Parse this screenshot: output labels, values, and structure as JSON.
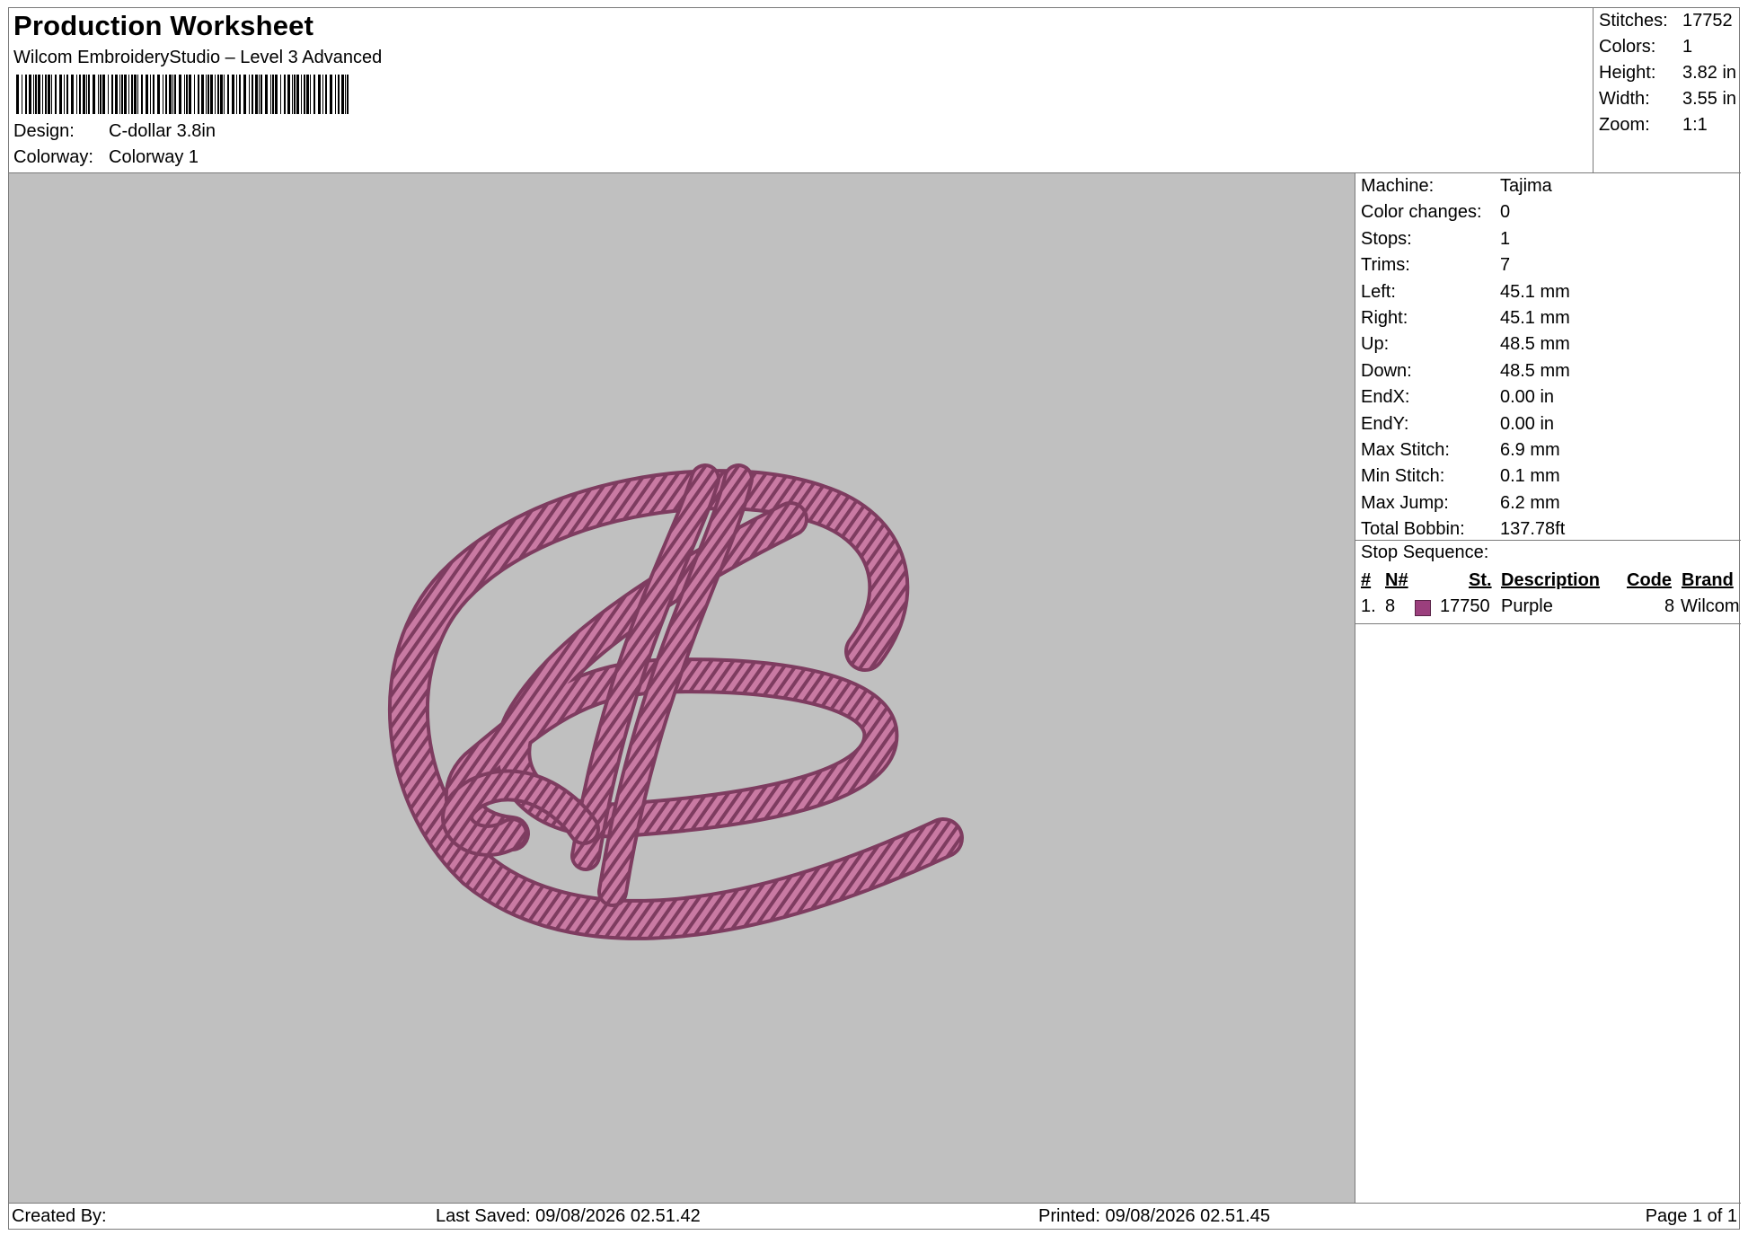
{
  "header": {
    "title": "Production Worksheet",
    "software": "Wilcom EmbroideryStudio – Level 3 Advanced",
    "design_label": "Design:",
    "design_value": "C-dollar 3.8in",
    "colorway_label": "Colorway:",
    "colorway_value": "Colorway 1"
  },
  "stats": [
    {
      "label": "Stitches:",
      "value": "17752"
    },
    {
      "label": "Colors:",
      "value": "1"
    },
    {
      "label": "Height:",
      "value": "3.82 in"
    },
    {
      "label": "Width:",
      "value": "3.55 in"
    },
    {
      "label": "Zoom:",
      "value": "1:1"
    }
  ],
  "machine_info": [
    {
      "label": "Machine:",
      "value": "Tajima"
    },
    {
      "label": "Color changes:",
      "value": "0"
    },
    {
      "label": "Stops:",
      "value": "1"
    },
    {
      "label": "Trims:",
      "value": "7"
    },
    {
      "label": "Left:",
      "value": "45.1 mm"
    },
    {
      "label": "Right:",
      "value": "45.1 mm"
    },
    {
      "label": "Up:",
      "value": "48.5 mm"
    },
    {
      "label": "Down:",
      "value": "48.5 mm"
    },
    {
      "label": "EndX:",
      "value": "0.00 in"
    },
    {
      "label": "EndY:",
      "value": "0.00 in"
    },
    {
      "label": "Max Stitch:",
      "value": "6.9 mm"
    },
    {
      "label": "Min Stitch:",
      "value": "0.1 mm"
    },
    {
      "label": "Max Jump:",
      "value": "6.2 mm"
    },
    {
      "label": "Total Bobbin:",
      "value": "137.78ft"
    }
  ],
  "stop_sequence": {
    "title": "Stop Sequence:",
    "headers": {
      "num": "#",
      "n": "N#",
      "st": "St.",
      "description": "Description",
      "code": "Code",
      "brand": "Brand"
    },
    "rows": [
      {
        "num": "1.",
        "n": "8",
        "color": "#9b3f7d",
        "st": "17750",
        "description": "Purple",
        "code": "8",
        "brand": "Wilcom"
      }
    ]
  },
  "footer": {
    "created_by": "Created By:",
    "last_saved": "Last Saved: 09/08/2026 02.51.42",
    "printed": "Printed: 09/08/2026 02.51.45",
    "page": "Page 1 of 1"
  },
  "colors": {
    "canvas_bg": "#c0c0c0",
    "thread_light": "#c97aa3",
    "thread_dark": "#7e3c60"
  }
}
